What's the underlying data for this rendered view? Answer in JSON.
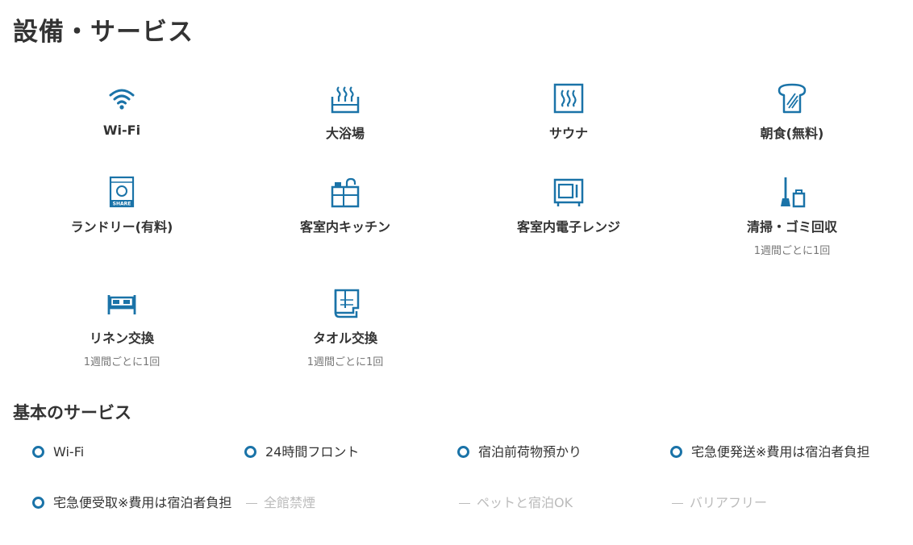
{
  "page": {
    "title": "設備・サービス",
    "accent_color": "#1a73a8"
  },
  "facilities": [
    {
      "icon": "wifi-icon",
      "label": "Wi-Fi",
      "note": ""
    },
    {
      "icon": "bath-icon",
      "label": "大浴場",
      "note": ""
    },
    {
      "icon": "sauna-icon",
      "label": "サウナ",
      "note": ""
    },
    {
      "icon": "bread-icon",
      "label": "朝食(無料)",
      "note": ""
    },
    {
      "icon": "washing-machine-icon",
      "label": "ランドリー(有料)",
      "note": ""
    },
    {
      "icon": "kitchen-icon",
      "label": "客室内キッチン",
      "note": ""
    },
    {
      "icon": "microwave-icon",
      "label": "客室内電子レンジ",
      "note": ""
    },
    {
      "icon": "broom-icon",
      "label": "清掃・ゴミ回収",
      "note": "1週間ごとに1回"
    },
    {
      "icon": "bed-icon",
      "label": "リネン交換",
      "note": "1週間ごとに1回"
    },
    {
      "icon": "towel-icon",
      "label": "タオル交換",
      "note": "1週間ごとに1回"
    }
  ],
  "basic_services": {
    "title": "基本のサービス",
    "items": [
      {
        "label": "Wi-Fi",
        "available": true
      },
      {
        "label": "24時間フロント",
        "available": true
      },
      {
        "label": "宿泊前荷物預かり",
        "available": true
      },
      {
        "label": "宅急便発送※費用は宿泊者負担",
        "available": true
      },
      {
        "label": "宅急便受取※費用は宿泊者負担",
        "available": true
      },
      {
        "label": "全館禁煙",
        "available": false
      },
      {
        "label": "ペットと宿泊OK",
        "available": false
      },
      {
        "label": "バリアフリー",
        "available": false
      }
    ]
  }
}
